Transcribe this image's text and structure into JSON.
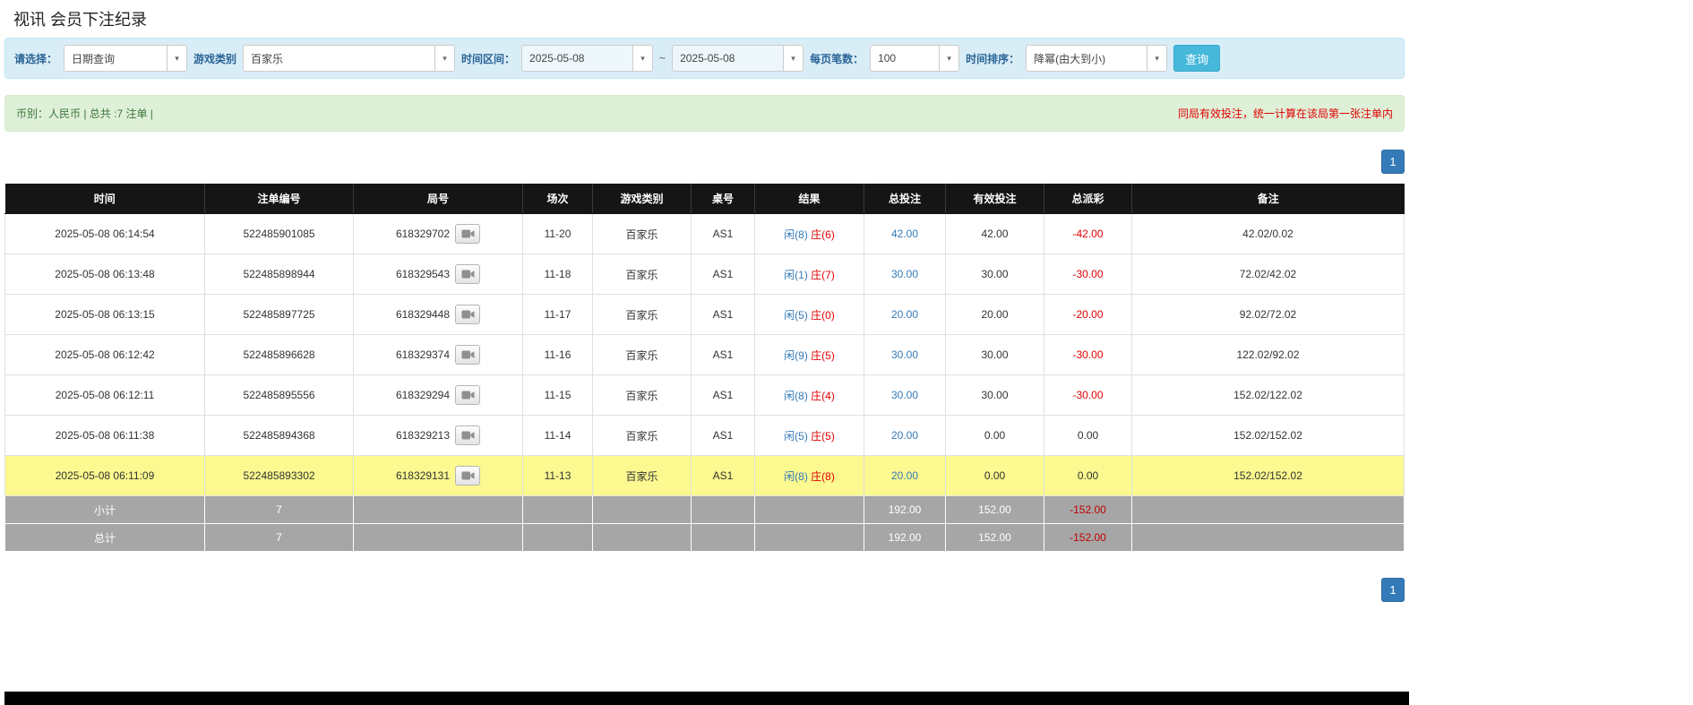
{
  "page": {
    "title": "视讯 会员下注纪录"
  },
  "filter": {
    "select_label": "请选择：",
    "select_value": "日期查询",
    "game_label": "游戏类别",
    "game_value": "百家乐",
    "range_label": "时间区间：",
    "date_from": "2025-05-08",
    "range_separator": "~",
    "date_to": "2025-05-08",
    "page_size_label": "每页笔数：",
    "page_size_value": "100",
    "sort_label": "时间排序：",
    "sort_value": "降幂(由大到小)",
    "search_label": "查询"
  },
  "summary_bar": {
    "left_text": "币别：人民币 | 总共 :7 注单 |",
    "right_text": "同局有效投注，统一计算在该局第一张注单内"
  },
  "pagination": {
    "page_label": "1"
  },
  "table": {
    "headers": [
      "时间",
      "注单编号",
      "局号",
      "场次",
      "游戏类别",
      "桌号",
      "结果",
      "总投注",
      "有效投注",
      "总派彩",
      "备注"
    ],
    "rows": [
      {
        "time": "2025-05-08 06:14:54",
        "bet_no": "522485901085",
        "round_no": "618329702",
        "session": "11-20",
        "game": "百家乐",
        "table_no": "AS1",
        "result_player": "闲(8)",
        "result_banker": "庄(6)",
        "total_bet": "42.00",
        "valid_bet": "42.00",
        "payout": "-42.00",
        "note": "42.02/0.02",
        "highlighted": false
      },
      {
        "time": "2025-05-08 06:13:48",
        "bet_no": "522485898944",
        "round_no": "618329543",
        "session": "11-18",
        "game": "百家乐",
        "table_no": "AS1",
        "result_player": "闲(1)",
        "result_banker": "庄(7)",
        "total_bet": "30.00",
        "valid_bet": "30.00",
        "payout": "-30.00",
        "note": "72.02/42.02",
        "highlighted": false
      },
      {
        "time": "2025-05-08 06:13:15",
        "bet_no": "522485897725",
        "round_no": "618329448",
        "session": "11-17",
        "game": "百家乐",
        "table_no": "AS1",
        "result_player": "闲(5)",
        "result_banker": "庄(0)",
        "total_bet": "20.00",
        "valid_bet": "20.00",
        "payout": "-20.00",
        "note": "92.02/72.02",
        "highlighted": false
      },
      {
        "time": "2025-05-08 06:12:42",
        "bet_no": "522485896628",
        "round_no": "618329374",
        "session": "11-16",
        "game": "百家乐",
        "table_no": "AS1",
        "result_player": "闲(9)",
        "result_banker": "庄(5)",
        "total_bet": "30.00",
        "valid_bet": "30.00",
        "payout": "-30.00",
        "note": "122.02/92.02",
        "highlighted": false
      },
      {
        "time": "2025-05-08 06:12:11",
        "bet_no": "522485895556",
        "round_no": "618329294",
        "session": "11-15",
        "game": "百家乐",
        "table_no": "AS1",
        "result_player": "闲(8)",
        "result_banker": "庄(4)",
        "total_bet": "30.00",
        "valid_bet": "30.00",
        "payout": "-30.00",
        "note": "152.02/122.02",
        "highlighted": false
      },
      {
        "time": "2025-05-08 06:11:38",
        "bet_no": "522485894368",
        "round_no": "618329213",
        "session": "11-14",
        "game": "百家乐",
        "table_no": "AS1",
        "result_player": "闲(5)",
        "result_banker": "庄(5)",
        "total_bet": "20.00",
        "valid_bet": "0.00",
        "payout": "0.00",
        "note": "152.02/152.02",
        "highlighted": false
      },
      {
        "time": "2025-05-08 06:11:09",
        "bet_no": "522485893302",
        "round_no": "618329131",
        "session": "11-13",
        "game": "百家乐",
        "table_no": "AS1",
        "result_player": "闲(8)",
        "result_banker": "庄(8)",
        "total_bet": "20.00",
        "valid_bet": "0.00",
        "payout": "0.00",
        "note": "152.02/152.02",
        "highlighted": true
      }
    ],
    "subtotal": {
      "label": "小计",
      "count": "7",
      "total_bet": "192.00",
      "valid_bet": "152.00",
      "payout": "-152.00"
    },
    "grand_total": {
      "label": "总计",
      "count": "7",
      "total_bet": "192.00",
      "valid_bet": "152.00",
      "payout": "-152.00"
    }
  },
  "colors": {
    "accent_blue": "#337ab7",
    "accent_cyan": "#46b8da",
    "negative_red": "#e10000",
    "player_blue": "#337ab7",
    "banker_red": "#e10000",
    "highlight_yellow": "#fbf98f"
  }
}
